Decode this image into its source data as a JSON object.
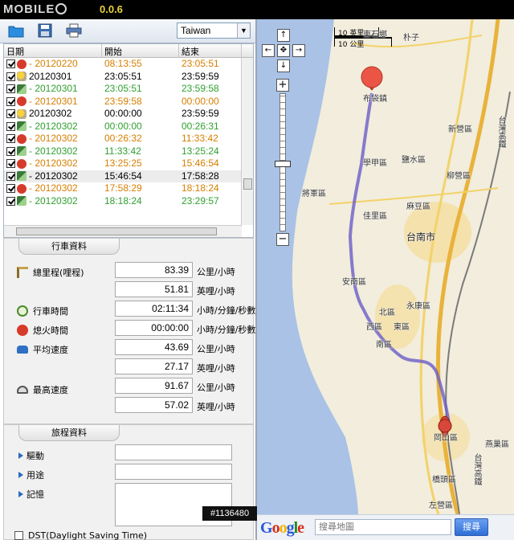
{
  "app": {
    "logo": "MOBILE",
    "logo_suffix": "01",
    "version": "0.0.6"
  },
  "toolbar": {
    "country": "Taiwan"
  },
  "trips": {
    "headers": [
      "日期",
      "開始",
      "結束"
    ],
    "rows": [
      {
        "date": " - 20120220",
        "start": "08:13:55",
        "end": "23:05:51",
        "icon": "stop",
        "color": "org"
      },
      {
        "date": "20120301",
        "start": "23:05:51",
        "end": "23:59:59",
        "icon": "day",
        "color": "blk"
      },
      {
        "date": " - 20120301",
        "start": "23:05:51",
        "end": "23:59:58",
        "icon": "drive",
        "color": "grn"
      },
      {
        "date": " - 20120301",
        "start": "23:59:58",
        "end": "00:00:00",
        "icon": "stop",
        "color": "org"
      },
      {
        "date": "20120302",
        "start": "00:00:00",
        "end": "23:59:59",
        "icon": "day",
        "color": "blk"
      },
      {
        "date": " - 20120302",
        "start": "00:00:00",
        "end": "00:26:31",
        "icon": "drive",
        "color": "grn"
      },
      {
        "date": " - 20120302",
        "start": "00:26:32",
        "end": "11:33:42",
        "icon": "stop",
        "color": "org"
      },
      {
        "date": " - 20120302",
        "start": "11:33:42",
        "end": "13:25:24",
        "icon": "drive",
        "color": "grn"
      },
      {
        "date": " - 20120302",
        "start": "13:25:25",
        "end": "15:46:54",
        "icon": "stop",
        "color": "org"
      },
      {
        "date": " - 20120302",
        "start": "15:46:54",
        "end": "17:58:28",
        "icon": "drive",
        "color": "blk",
        "selected": true
      },
      {
        "date": " - 20120302",
        "start": "17:58:29",
        "end": "18:18:24",
        "icon": "stop",
        "color": "org"
      },
      {
        "date": " - 20120302",
        "start": "18:18:24",
        "end": "23:29:57",
        "icon": "drive",
        "color": "grn"
      }
    ]
  },
  "driving": {
    "title": "行車資料",
    "total_distance_label": "總里程(哩程)",
    "total_km": "83.39",
    "total_km_unit": "公里/小時",
    "total_mi": "51.81",
    "total_mi_unit": "英哩/小時",
    "drive_time_label": "行車時間",
    "drive_time": "02:11:34",
    "drive_time_unit": "小時/分鐘/秒數",
    "idle_time_label": "熄火時間",
    "idle_time": "00:00:00",
    "idle_time_unit": "小時/分鐘/秒數",
    "avg_speed_label": "平均速度",
    "avg_km": "43.69",
    "avg_km_unit": "公里/小時",
    "avg_mi": "27.17",
    "avg_mi_unit": "英哩/小時",
    "max_speed_label": "最高速度",
    "max_km": "91.67",
    "max_km_unit": "公里/小時",
    "max_mi": "57.02",
    "max_mi_unit": "英哩/小時"
  },
  "trip_info": {
    "title": "旅程資料",
    "drive_label": "驅動",
    "purpose_label": "用途",
    "notes_label": "記憶",
    "dst_label": "DST(Daylight Saving Time)"
  },
  "map": {
    "scale_top": "10 英里",
    "scale_bottom": "10 公里",
    "places": {
      "p1": "東石鄉",
      "p2": "朴子",
      "p3": "布袋鎮",
      "p4": "新營區",
      "p5": "鹽水區",
      "p6": "學甲區",
      "p7": "柳營區",
      "p8": "將軍區",
      "p9": "佳里區",
      "p10": "麻豆區",
      "p11": "台南市",
      "p12": "安南區",
      "p13": "永康區",
      "p14": "北區",
      "p15": "西區",
      "p16": "南區",
      "p17": "東區",
      "p18": "岡山區",
      "p19": "橋頭區",
      "p20": "左營區",
      "p21": "燕巢區",
      "p22": "台灣高鐵",
      "p23": "台灣高鐵"
    },
    "zoom_plus": "+",
    "zoom_minus": "−",
    "search_placeholder": "搜尋地圖",
    "search_button": "搜尋",
    "google": [
      "G",
      "o",
      "o",
      "g",
      "l",
      "e"
    ]
  },
  "watermark": "#1136480"
}
